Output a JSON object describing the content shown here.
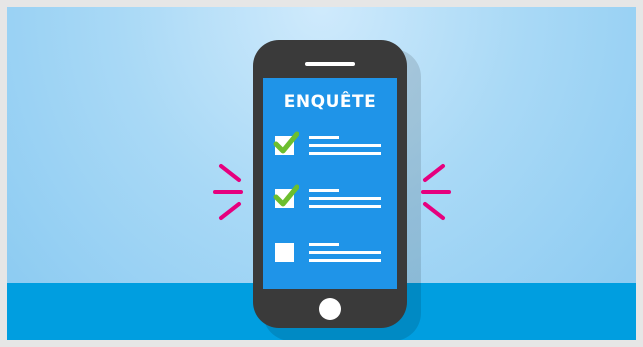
{
  "illustration": {
    "screen_title": "ENQUÊTE",
    "checklist": [
      {
        "checked": true
      },
      {
        "checked": true
      },
      {
        "checked": false
      }
    ],
    "icons": {
      "check": "check-mark-icon",
      "phone": "smartphone-icon",
      "vibration": "vibration-rays-icon"
    },
    "colors": {
      "background_sky": "#a9d9f6",
      "ground": "#009ee0",
      "phone_body": "#3a3a3a",
      "screen": "#1f94e8",
      "check": "#6cbe2e",
      "rays": "#e6007e"
    }
  }
}
